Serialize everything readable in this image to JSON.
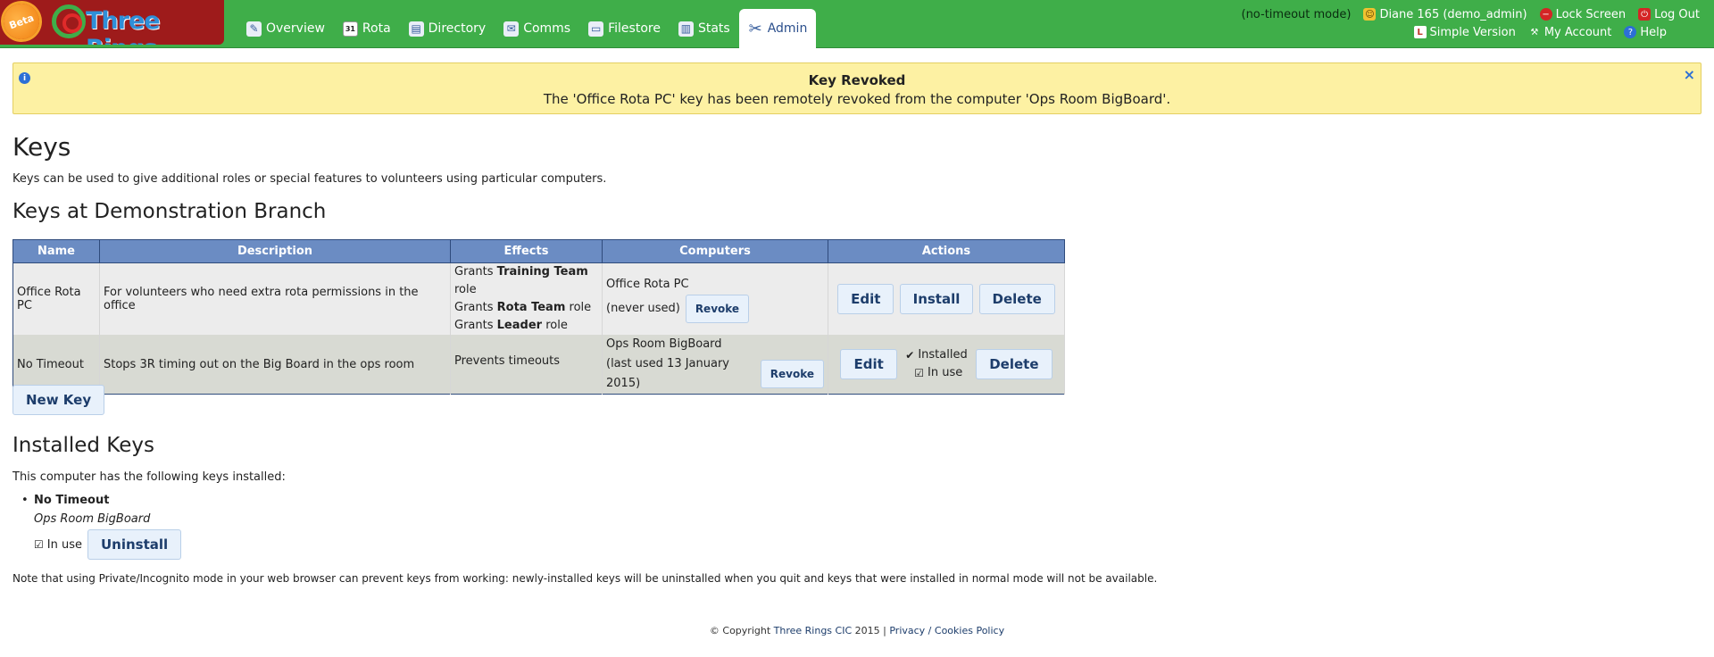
{
  "logo": {
    "badge": "Beta",
    "name": "Three Rings"
  },
  "nav": {
    "tabs": [
      {
        "label": "Overview",
        "icon": "overview-icon"
      },
      {
        "label": "Rota",
        "icon": "calendar-icon",
        "glyph": "31"
      },
      {
        "label": "Directory",
        "icon": "directory-icon"
      },
      {
        "label": "Comms",
        "icon": "comms-icon"
      },
      {
        "label": "Filestore",
        "icon": "folder-icon"
      },
      {
        "label": "Stats",
        "icon": "stats-icon"
      },
      {
        "label": "Admin",
        "icon": "tools-icon",
        "active": true
      }
    ]
  },
  "user": {
    "mode": "(no-timeout mode)",
    "name": "Diane 165 (demo_admin)",
    "lock": "Lock Screen",
    "logout": "Log Out",
    "simple": "Simple Version",
    "account": "My Account",
    "help": "Help"
  },
  "flash": {
    "title": "Key Revoked",
    "message": "The 'Office Rota PC' key has been remotely revoked from the computer 'Ops Room BigBoard'.",
    "close": "×"
  },
  "page": {
    "title": "Keys",
    "intro": "Keys can be used to give additional roles or special features to volunteers using particular computers.",
    "branch_heading": "Keys at Demonstration Branch"
  },
  "table": {
    "headers": [
      "Name",
      "Description",
      "Effects",
      "Computers",
      "Actions"
    ],
    "rows": [
      {
        "name": "Office Rota PC",
        "description": "For volunteers who need extra rota permissions in the office",
        "effects": [
          {
            "pre": "Grants ",
            "bold": "Training Team",
            "post": " role"
          },
          {
            "pre": "Grants ",
            "bold": "Rota Team",
            "post": " role"
          },
          {
            "pre": "Grants ",
            "bold": "Leader",
            "post": " role"
          }
        ],
        "computer": "Office Rota PC",
        "usage": "(never used)",
        "revoke": "Revoke",
        "edit": "Edit",
        "install": "Install",
        "delete": "Delete"
      },
      {
        "name": "No Timeout",
        "description": "Stops 3R timing out on the Big Board in the ops room",
        "effect": "Prevents timeouts",
        "computer": "Ops Room BigBoard",
        "usage": "(last used 13 January 2015)",
        "revoke": "Revoke",
        "edit": "Edit",
        "installed": "Installed",
        "in_use": "In use",
        "delete": "Delete"
      }
    ]
  },
  "new_key": "New Key",
  "installed": {
    "heading": "Installed Keys",
    "intro": "This computer has the following keys installed:",
    "key_name": "No Timeout",
    "computer": "Ops Room BigBoard",
    "in_use": "In use",
    "uninstall": "Uninstall"
  },
  "note": "Note that using Private/Incognito mode in your web browser can prevent keys from working: newly-installed keys will be uninstalled when you quit and keys that were installed in normal mode will not be available.",
  "footer": {
    "copyright": "© Copyright",
    "org": "Three Rings CIC",
    "year": "2015",
    "sep": "|",
    "privacy": "Privacy / Cookies Policy"
  },
  "colors": {
    "topbar": "#3fae49",
    "header_blue": "#6b8cc3",
    "flash_bg": "#fdf1a3"
  }
}
